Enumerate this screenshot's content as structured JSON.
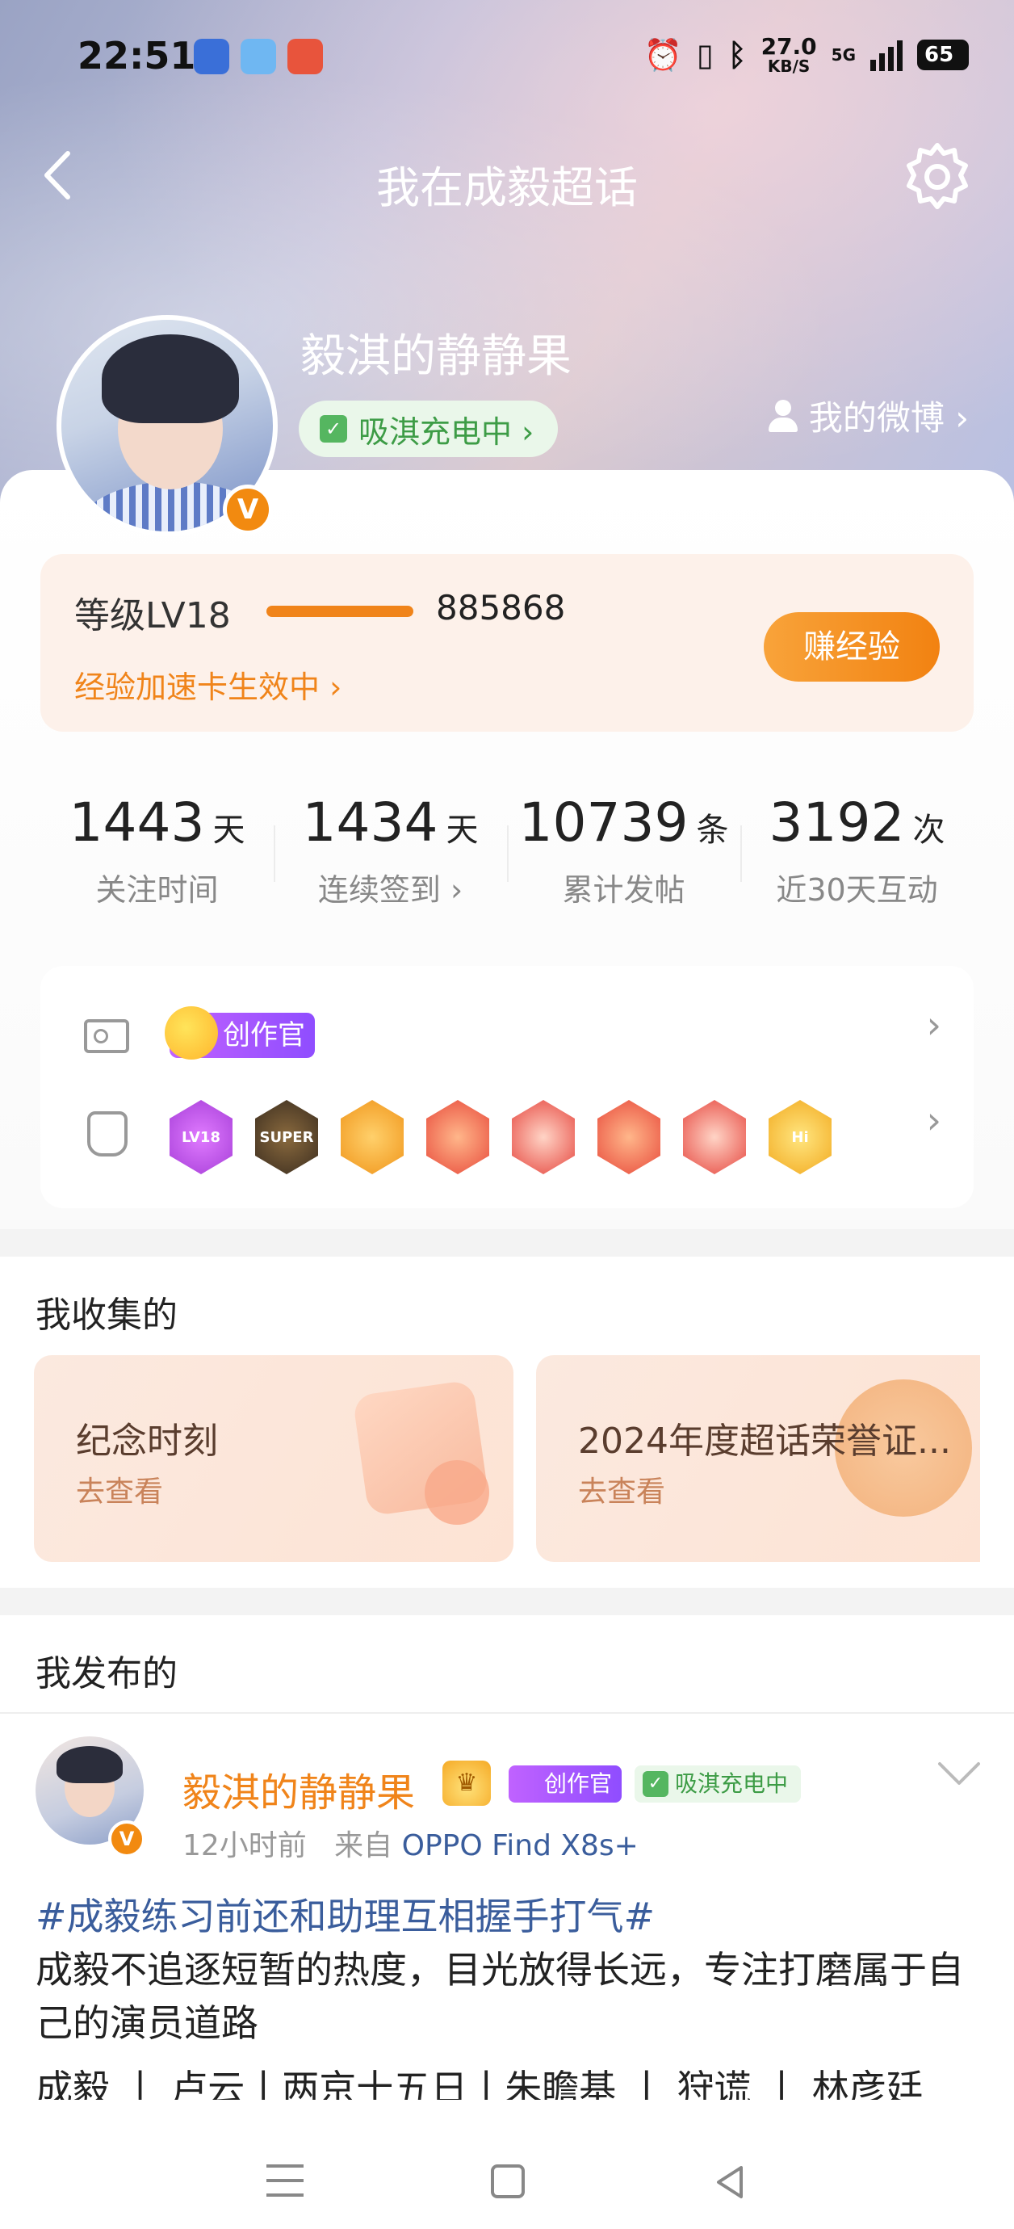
{
  "status_bar": {
    "time": "22:51",
    "net_speed": "27.0",
    "net_unit": "KB/S",
    "network": "5G",
    "battery": "65"
  },
  "nav": {
    "title": "我在成毅超话"
  },
  "profile": {
    "username": "毅淇的静静果",
    "verified_mark": "V",
    "charge_label": "吸淇充电中 ›",
    "my_weibo": "我的微博 ›"
  },
  "level": {
    "label": "等级LV18",
    "progress": 1.0,
    "exp": "885868",
    "speed_card": "经验加速卡生效中 ›",
    "earn_button": "赚经验"
  },
  "stats": [
    {
      "value": "1443",
      "unit": "天",
      "label": "关注时间"
    },
    {
      "value": "1434",
      "unit": "天",
      "label": "连续签到 ›"
    },
    {
      "value": "10739",
      "unit": "条",
      "label": "累计发帖"
    },
    {
      "value": "3192",
      "unit": "次",
      "label": "近30天互动"
    }
  ],
  "badges": {
    "creator_tag": "创作官",
    "chevron": "›",
    "medals": [
      {
        "icon": "lv18-medal",
        "text": "LV18"
      },
      {
        "icon": "super-medal",
        "text": "SUPER"
      },
      {
        "icon": "wings-medal",
        "text": ""
      },
      {
        "icon": "rabbit-medal",
        "text": ""
      },
      {
        "icon": "rabbit-medal",
        "text": ""
      },
      {
        "icon": "rabbit-medal",
        "text": ""
      },
      {
        "icon": "rabbit-medal",
        "text": ""
      },
      {
        "icon": "hi-medal",
        "text": "Hi"
      }
    ]
  },
  "collections": {
    "title": "我收集的",
    "cards": [
      {
        "title": "纪念时刻",
        "sub": "去查看"
      },
      {
        "title": "2024年度超话荣誉证...",
        "sub": "去查看"
      }
    ]
  },
  "posts": {
    "title": "我发布的",
    "author": "毅淇的静静果",
    "crown": "♛",
    "creator_tag": "创作官",
    "charge_tag": "吸淇充电中",
    "time": "12小时前",
    "from": "来自",
    "device": "OPPO Find X8s+",
    "hashtag": "#成毅练习前还和助理互相握手打气#",
    "body": "成毅不追逐短暂的热度，目光放得长远，专注打磨属于自己的演员道路",
    "tags_line": "成毅 丨 卢云丨两京十五日丨朱瞻基 丨 狩谎 丨 林彦廷"
  },
  "colors": {
    "accent": "#f0841a",
    "link": "#3a5d9c",
    "green": "#3d9c46"
  }
}
